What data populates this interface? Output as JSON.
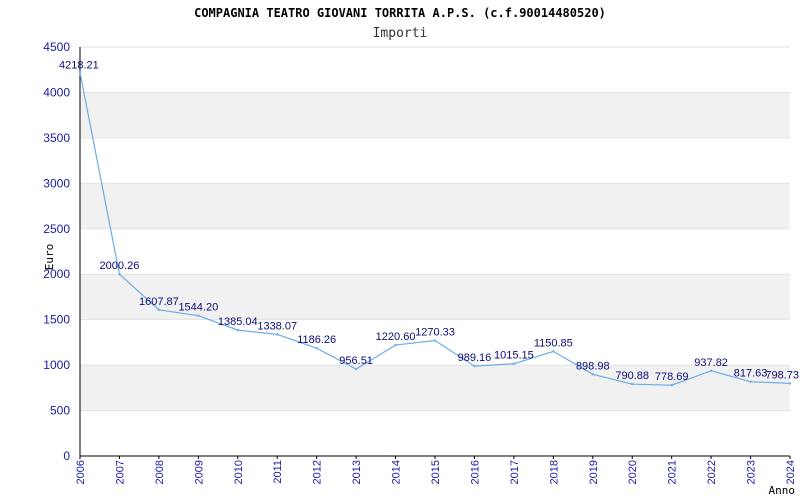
{
  "chart_data": {
    "type": "line",
    "title": "COMPAGNIA TEATRO GIOVANI TORRITA A.P.S. (c.f.90014480520)",
    "subtitle": "Importi",
    "xlabel": "Anno",
    "ylabel": "Euro",
    "ylim": [
      0,
      4500
    ],
    "yticks": [
      0,
      500,
      1000,
      1500,
      2000,
      2500,
      3000,
      3500,
      4000,
      4500
    ],
    "grid": "horizontal alternating bands",
    "categories": [
      "2006",
      "2007",
      "2008",
      "2009",
      "2010",
      "2011",
      "2012",
      "2013",
      "2014",
      "2015",
      "2016",
      "2017",
      "2018",
      "2019",
      "2020",
      "2021",
      "2022",
      "2023",
      "2024"
    ],
    "values": [
      4218.21,
      2000.26,
      1607.87,
      1544.2,
      1385.04,
      1338.07,
      1186.26,
      956.51,
      1220.6,
      1270.33,
      989.16,
      1015.15,
      1150.85,
      898.98,
      790.88,
      778.69,
      937.82,
      817.63,
      798.73
    ],
    "value_labels": [
      "4218.21",
      "2000.26",
      "1607.87",
      "1544.20",
      "1385.04",
      "1338.07",
      "1186.26",
      "956.51",
      "1220.60",
      "1270.33",
      "989.16",
      "1015.15",
      "1150.85",
      "898.98",
      "790.88",
      "778.69",
      "937.82",
      "817.63",
      "798.73"
    ],
    "colors": {
      "line": "#6aaee8",
      "band": "#f1f1f1",
      "axis": "#000000",
      "tick_text": "#1a1aa8",
      "label_text": "#0b0b78"
    }
  }
}
